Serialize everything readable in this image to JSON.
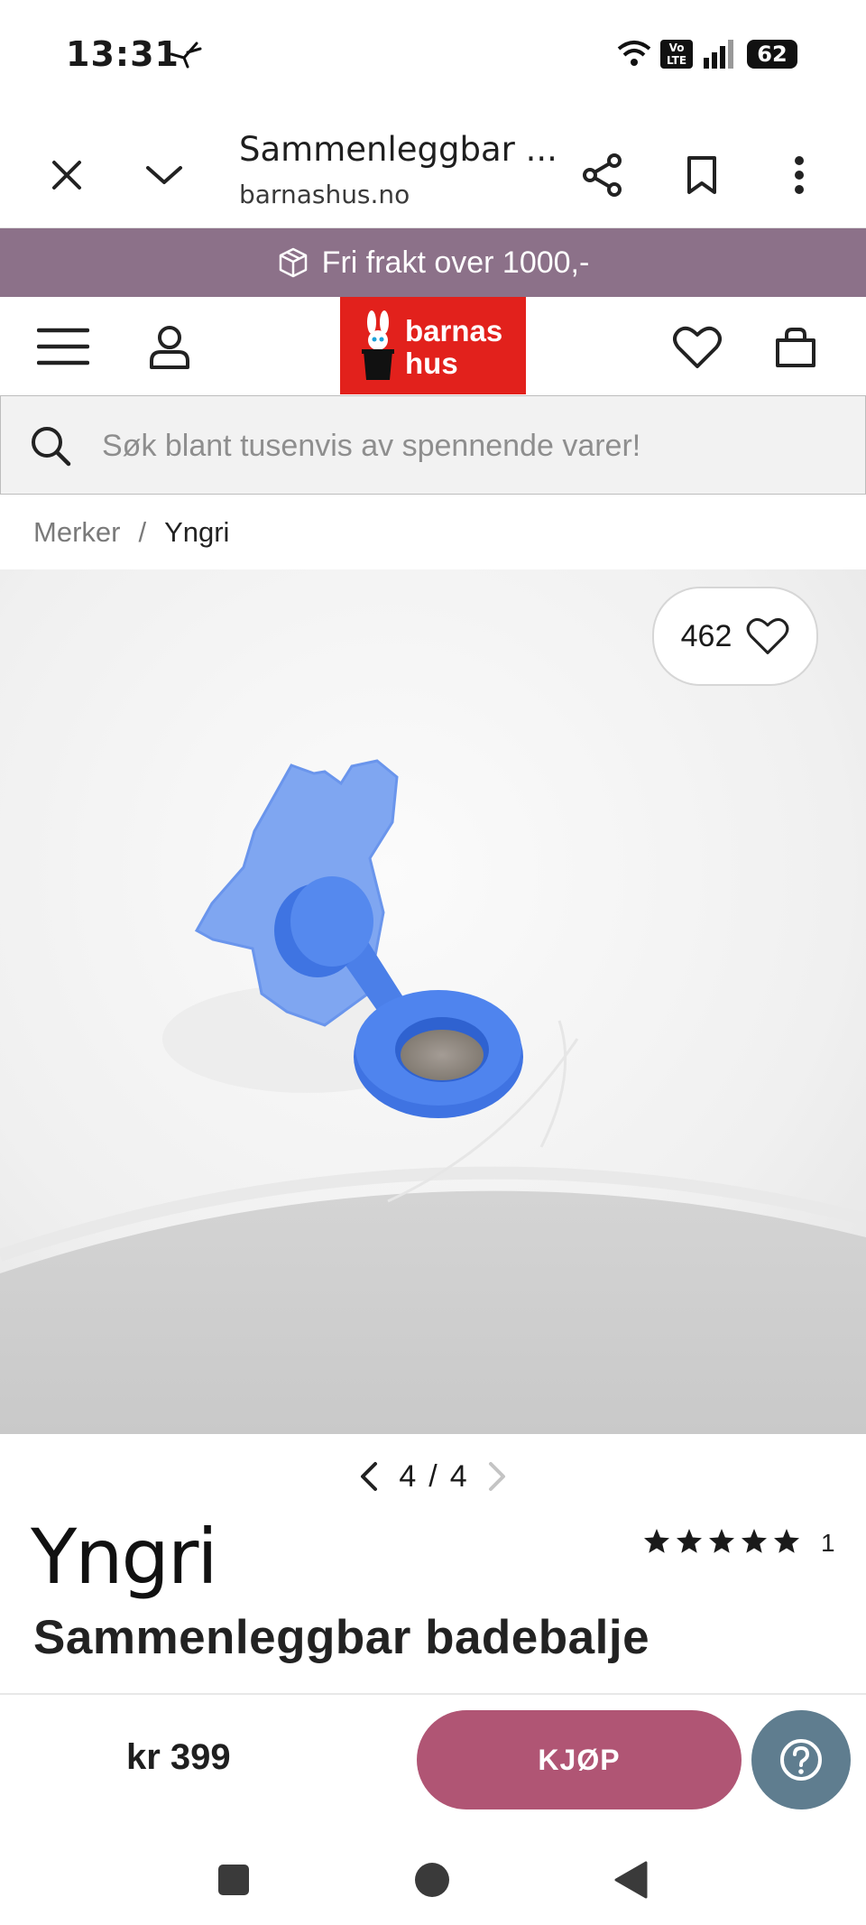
{
  "status_bar": {
    "time": "13:31",
    "battery": "62"
  },
  "browser": {
    "title": "Sammenleggbar ...",
    "url": "barnashus.no"
  },
  "promo": {
    "text": "Fri frakt over 1000,-"
  },
  "site": {
    "logo_line1": "barnas",
    "logo_line2": "hus"
  },
  "search": {
    "placeholder": "Søk blant tusenvis av spennende varer!"
  },
  "breadcrumb": {
    "items": [
      "Merker",
      "Yngri"
    ],
    "separator": "/"
  },
  "product": {
    "likes": "462",
    "pager_current": "4",
    "pager_sep": "/",
    "pager_total": "4",
    "brand": "Yngri",
    "rating_stars": 5,
    "rating_count": "1",
    "title": "Sammenleggbar badebalje",
    "price": "kr 399",
    "buy_label": "KJØP"
  },
  "colors": {
    "promo_bg": "#8c7189",
    "logo_bg": "#e2211c",
    "buy_bg": "#b05574",
    "help_bg": "#5f7d8f",
    "product_plug": "#5b8ff0"
  }
}
